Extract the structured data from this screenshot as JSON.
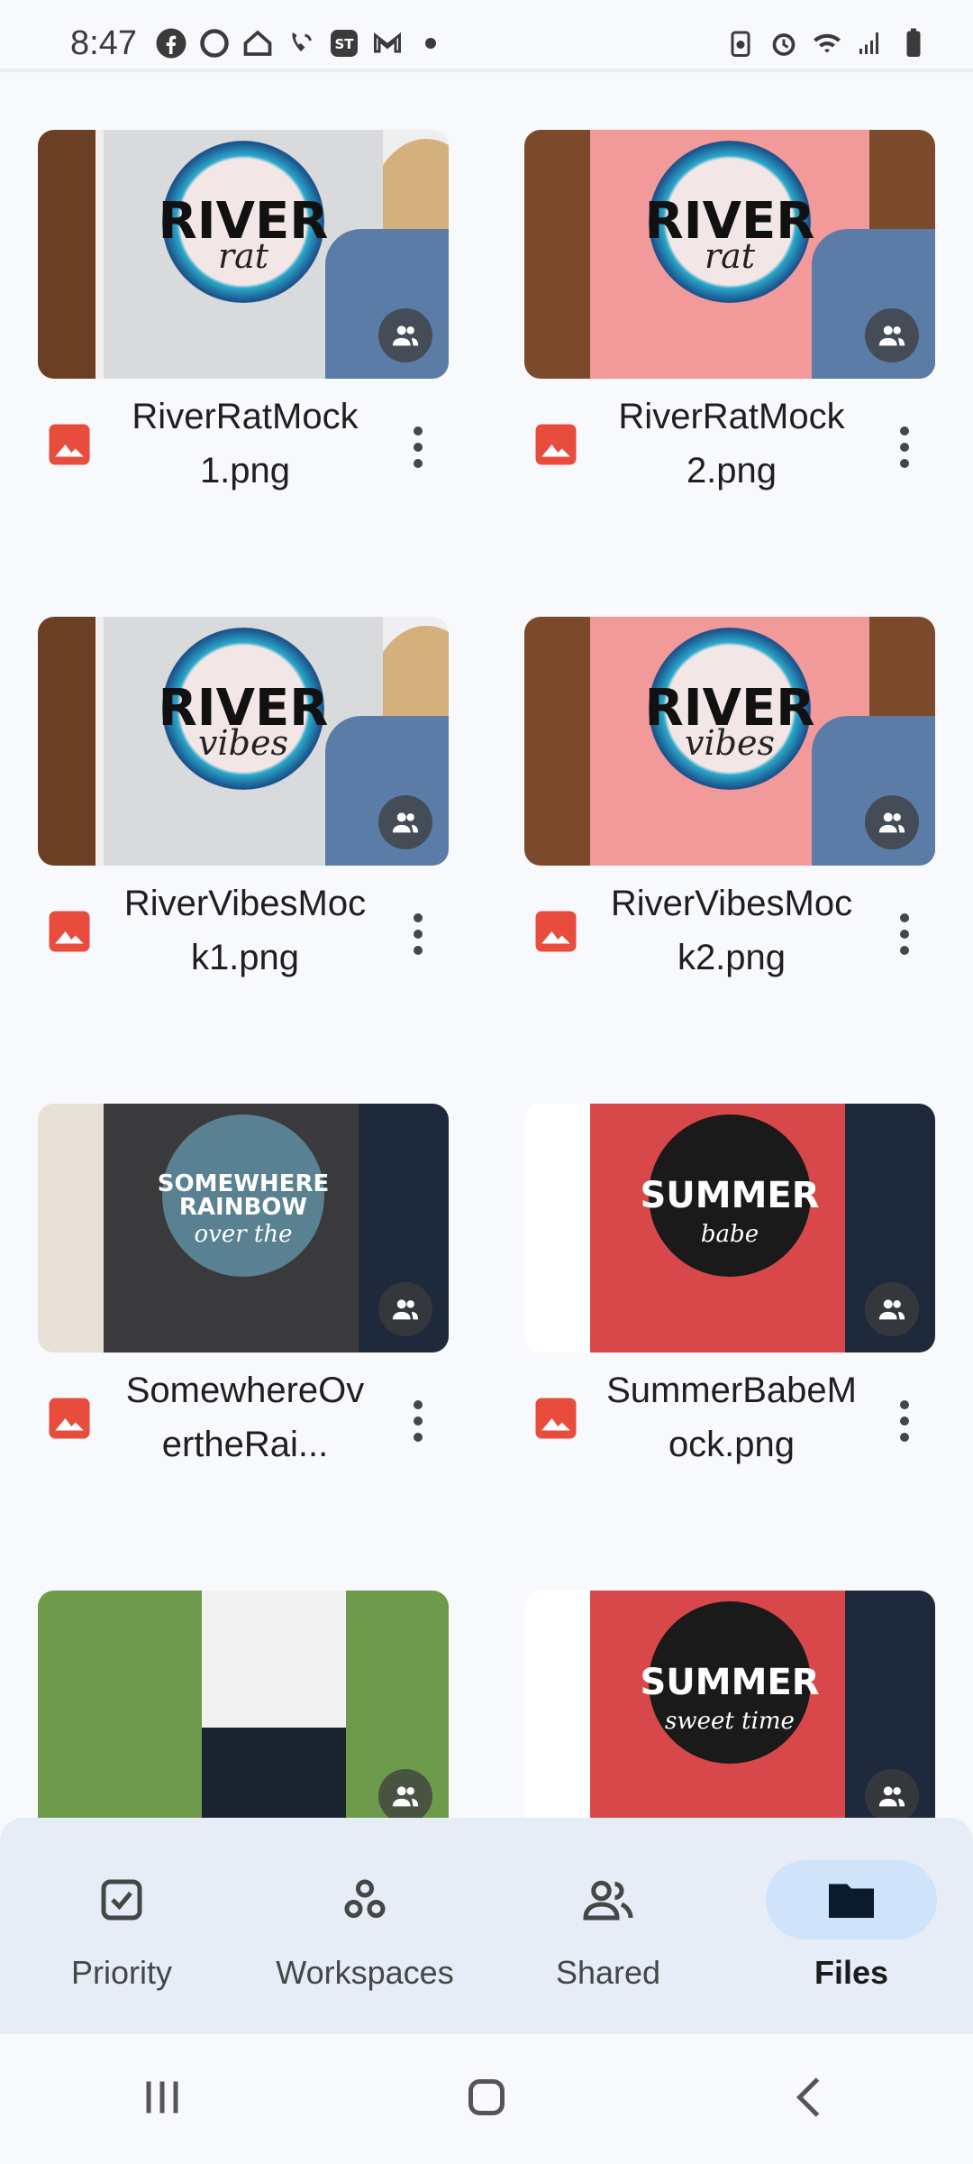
{
  "status": {
    "time": "8:47",
    "left_icons": [
      "facebook-icon",
      "circle-app-icon",
      "home-icon",
      "wifi-call-icon",
      "st-icon",
      "gmail-icon",
      "dot-icon"
    ],
    "right_icons": [
      "battery-saver-icon",
      "alarm-icon",
      "wifi-icon",
      "signal-icon",
      "battery-icon"
    ]
  },
  "files": [
    {
      "name": "RiverRatMock1.png",
      "design_title": "RIVER",
      "design_sub": "rat",
      "shirt_color": "#d9dadb",
      "style": "gray"
    },
    {
      "name": "RiverRatMock2.png",
      "design_title": "RIVER",
      "design_sub": "rat",
      "shirt_color": "#f29a9a",
      "style": "pink"
    },
    {
      "name": "RiverVibesMock1.png",
      "design_title": "RIVER",
      "design_sub": "vibes",
      "shirt_color": "#d9dadb",
      "style": "gray"
    },
    {
      "name": "RiverVibesMock2.png",
      "design_title": "RIVER",
      "design_sub": "vibes",
      "shirt_color": "#f29a9a",
      "style": "pink"
    },
    {
      "name": "SomewhereOvertheRai...",
      "design_title": "SOMEWHERE RAINBOW",
      "design_sub": "over the",
      "shirt_color": "#3a3a3c",
      "style": "dark"
    },
    {
      "name": "SummerBabeMock.png",
      "design_title": "SUMMER",
      "design_sub": "babe",
      "shirt_color": "#d8484a",
      "style": "red"
    },
    {
      "name": "",
      "design_title": "",
      "design_sub": "",
      "shirt_color": "#f3f3f3",
      "style": "photo"
    },
    {
      "name": "",
      "design_title": "SUMMER",
      "design_sub": "sweet time",
      "shirt_color": "#d8484a",
      "style": "red"
    }
  ],
  "nav": {
    "items": [
      {
        "label": "Priority",
        "icon": "priority-check-icon"
      },
      {
        "label": "Workspaces",
        "icon": "workspaces-icon"
      },
      {
        "label": "Shared",
        "icon": "shared-people-icon"
      },
      {
        "label": "Files",
        "icon": "folder-icon"
      }
    ],
    "active": "Files"
  },
  "system_nav": [
    "recents-icon",
    "home-icon",
    "back-icon"
  ],
  "colors": {
    "accent": "#cfe3fb",
    "file_icon": "#e84c3d",
    "nav_bg": "#e6edf6"
  }
}
